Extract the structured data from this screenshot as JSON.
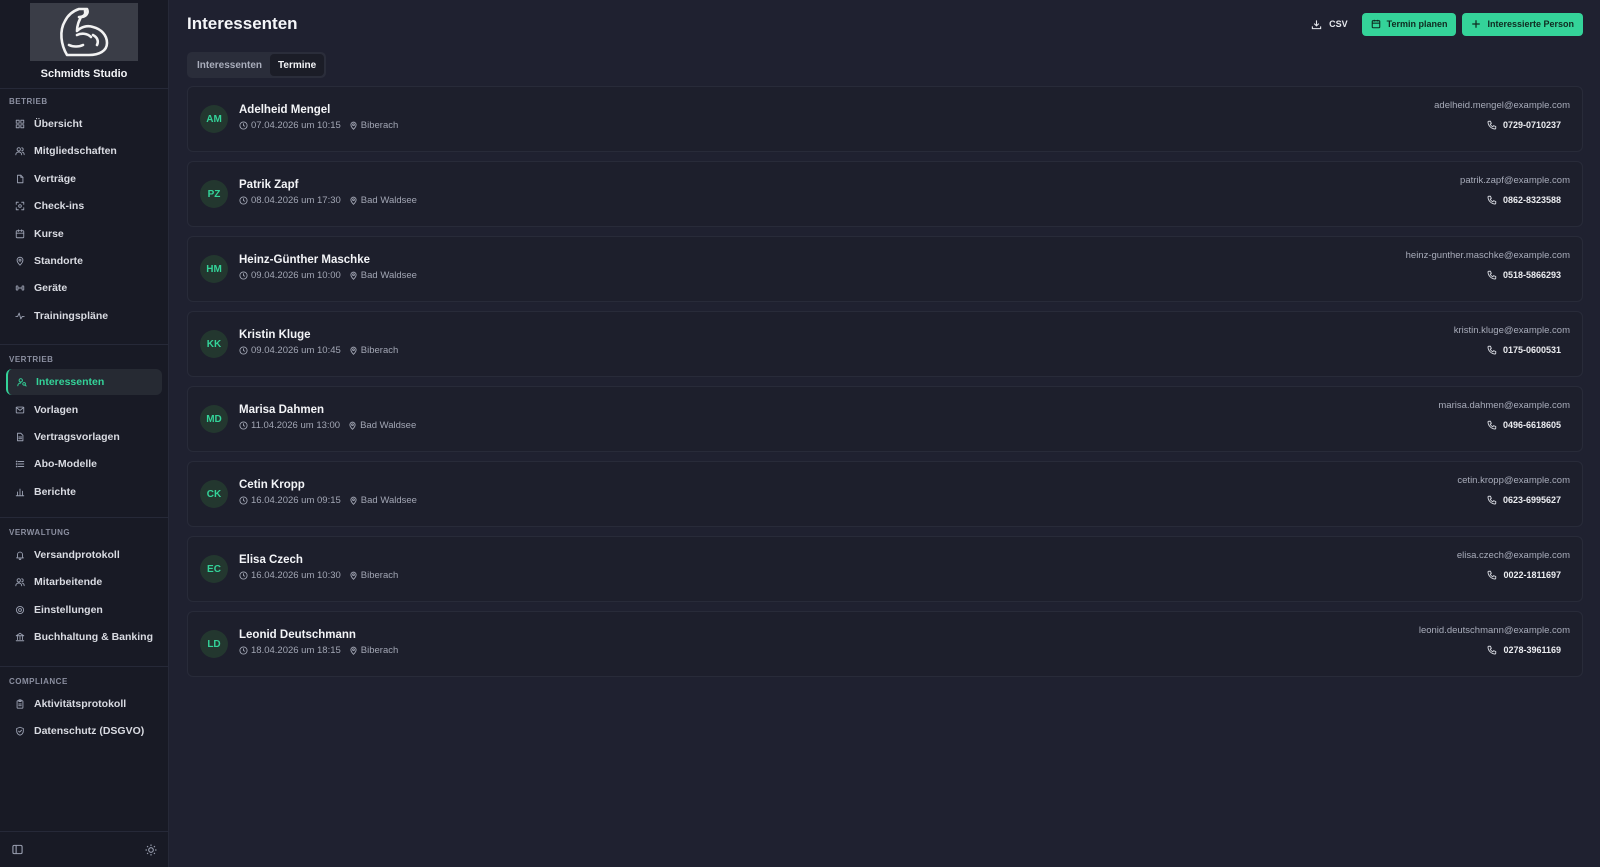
{
  "brand": {
    "name": "Schmidts Studio"
  },
  "sidebar": {
    "sections": [
      {
        "label": "BETRIEB",
        "items": [
          {
            "label": "Übersicht",
            "icon": "grid-icon"
          },
          {
            "label": "Mitgliedschaften",
            "icon": "users-icon"
          },
          {
            "label": "Verträge",
            "icon": "file-icon"
          },
          {
            "label": "Check-ins",
            "icon": "scan-icon"
          },
          {
            "label": "Kurse",
            "icon": "calendar-icon"
          },
          {
            "label": "Standorte",
            "icon": "map-pin-icon"
          },
          {
            "label": "Geräte",
            "icon": "dumbbell-icon"
          },
          {
            "label": "Trainingspläne",
            "icon": "activity-icon"
          }
        ]
      },
      {
        "label": "VERTRIEB",
        "items": [
          {
            "label": "Interessenten",
            "icon": "user-search-icon",
            "active": true
          },
          {
            "label": "Vorlagen",
            "icon": "mail-icon"
          },
          {
            "label": "Vertragsvorlagen",
            "icon": "file-text-icon"
          },
          {
            "label": "Abo-Modelle",
            "icon": "list-icon"
          },
          {
            "label": "Berichte",
            "icon": "bar-chart-icon"
          }
        ]
      },
      {
        "label": "VERWALTUNG",
        "items": [
          {
            "label": "Versandprotokoll",
            "icon": "bell-icon"
          },
          {
            "label": "Mitarbeitende",
            "icon": "users-icon"
          },
          {
            "label": "Einstellungen",
            "icon": "gear-icon"
          },
          {
            "label": "Buchhaltung & Banking",
            "icon": "bank-icon"
          }
        ]
      },
      {
        "label": "COMPLIANCE",
        "items": [
          {
            "label": "Aktivitätsprotokoll",
            "icon": "clipboard-icon"
          },
          {
            "label": "Datenschutz (DSGVO)",
            "icon": "shield-icon"
          }
        ]
      }
    ]
  },
  "header": {
    "title": "Interessenten",
    "csv_label": "CSV",
    "schedule_label": "Termin planen",
    "add_label": "Interessierte Person"
  },
  "tabs": [
    {
      "label": "Interessenten",
      "active": false
    },
    {
      "label": "Termine",
      "active": true
    }
  ],
  "appointments": [
    {
      "initials": "AM",
      "name": "Adelheid Mengel",
      "datetime": "07.04.2026 um 10:15",
      "location": "Biberach",
      "email": "adelheid.mengel@example.com",
      "phone": "0729-0710237"
    },
    {
      "initials": "PZ",
      "name": "Patrik Zapf",
      "datetime": "08.04.2026 um 17:30",
      "location": "Bad Waldsee",
      "email": "patrik.zapf@example.com",
      "phone": "0862-8323588"
    },
    {
      "initials": "HM",
      "name": "Heinz-Günther Maschke",
      "datetime": "09.04.2026 um 10:00",
      "location": "Bad Waldsee",
      "email": "heinz-gunther.maschke@example.com",
      "phone": "0518-5866293"
    },
    {
      "initials": "KK",
      "name": "Kristin Kluge",
      "datetime": "09.04.2026 um 10:45",
      "location": "Biberach",
      "email": "kristin.kluge@example.com",
      "phone": "0175-0600531"
    },
    {
      "initials": "MD",
      "name": "Marisa Dahmen",
      "datetime": "11.04.2026 um 13:00",
      "location": "Bad Waldsee",
      "email": "marisa.dahmen@example.com",
      "phone": "0496-6618605"
    },
    {
      "initials": "CK",
      "name": "Cetin Kropp",
      "datetime": "16.04.2026 um 09:15",
      "location": "Bad Waldsee",
      "email": "cetin.kropp@example.com",
      "phone": "0623-6995627"
    },
    {
      "initials": "EC",
      "name": "Elisa Czech",
      "datetime": "16.04.2026 um 10:30",
      "location": "Biberach",
      "email": "elisa.czech@example.com",
      "phone": "0022-1811697"
    },
    {
      "initials": "LD",
      "name": "Leonid Deutschmann",
      "datetime": "18.04.2026 um 18:15",
      "location": "Biberach",
      "email": "leonid.deutschmann@example.com",
      "phone": "0278-3961169"
    }
  ],
  "colors": {
    "accent": "#34d399",
    "sidebar_bg": "#181a25",
    "main_bg": "#1f2130"
  }
}
